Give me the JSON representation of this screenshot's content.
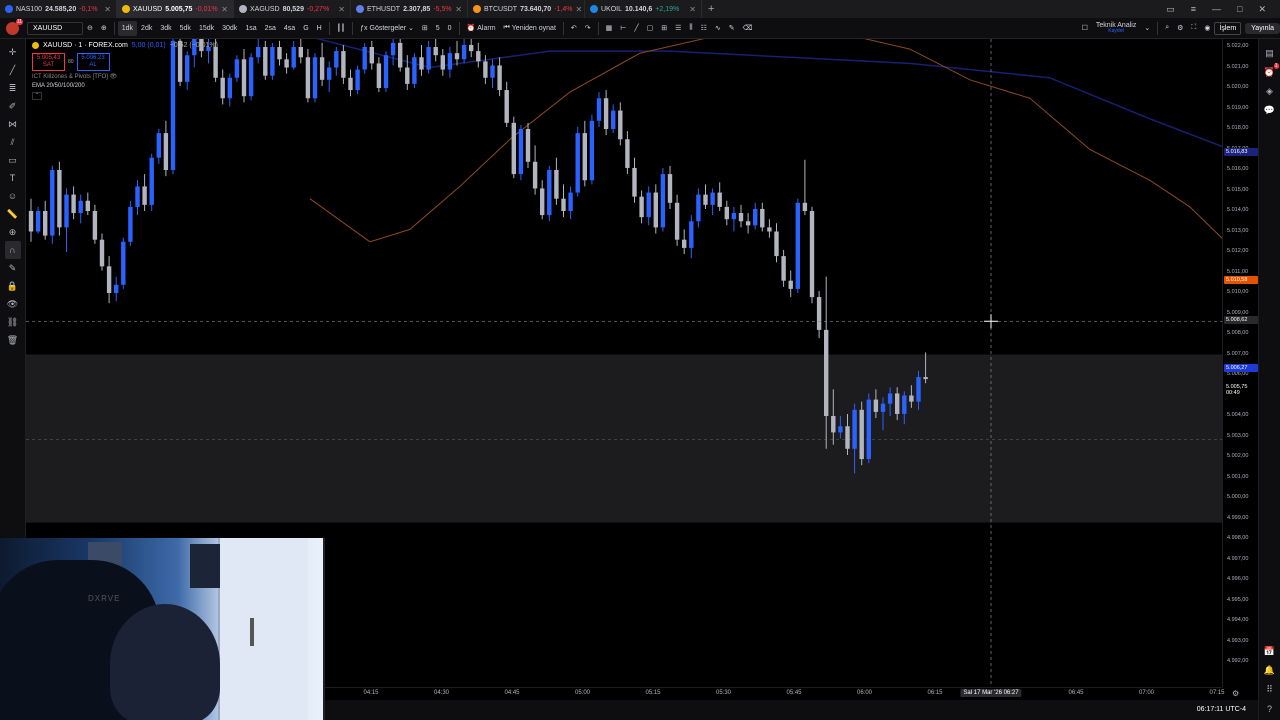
{
  "tabs": [
    {
      "symbol": "NAS100",
      "price": "24.585,20",
      "change": "-0,1%",
      "color": "#2962ff",
      "up": false
    },
    {
      "symbol": "XAUUSD",
      "price": "5.005,75",
      "change": "-0,01%",
      "color": "#f0b90b",
      "up": false,
      "active": true
    },
    {
      "symbol": "XAGUSD",
      "price": "80,529",
      "change": "-0,27%",
      "color": "#b2b5be",
      "up": false
    },
    {
      "symbol": "ETHUSDT",
      "price": "2.307,85",
      "change": "-5,5%",
      "color": "#627eea",
      "up": false
    },
    {
      "symbol": "BTCUSDT",
      "price": "73.640,70",
      "change": "-1,4%",
      "color": "#f7931a",
      "up": false
    },
    {
      "symbol": "UKOIL",
      "price": "10.140,6",
      "change": "+2,19%",
      "color": "#1e88e5",
      "up": true
    }
  ],
  "toolbar": {
    "symbol": "XAUUSD",
    "avatar_badge": "11",
    "intervals": [
      "1dk",
      "2dk",
      "3dk",
      "5dk",
      "15dk",
      "30dk",
      "1sa",
      "2sa",
      "4sa",
      "G",
      "H"
    ],
    "selected_interval": "1dk",
    "indicators_label": "Göstergeler",
    "templates_count": "5",
    "alerts_count": "0",
    "alarm_label": "Alarm",
    "replay_label": "Yeniden oynat",
    "analysis_label": "Teknik Analiz",
    "analysis_sub": "Kaydet",
    "trade_label": "İşlem",
    "publish_label": "Yayınla"
  },
  "legend": {
    "title": "XAUUSD · 1 · FOREX.com",
    "ohlc": "5,00 (0,01)",
    "change": "−0,52 (−0,01%)",
    "sell_price": "5.005,43",
    "sell_label": "SAT",
    "spread": "80",
    "buy_price": "5.006,23",
    "buy_label": "AL",
    "indicator1": "ICT Killzones & Pivots [TFO]",
    "indicator2": "EMA 20/50/100/200"
  },
  "price_axis": {
    "ticks": [
      "5.022,00",
      "5.021,00",
      "5.020,00",
      "5.019,00",
      "5.018,00",
      "5.017,00",
      "5.016,00",
      "5.015,00",
      "5.014,00",
      "5.013,00",
      "5.012,00",
      "5.011,00",
      "5.010,00",
      "5.009,00",
      "5.008,00",
      "5.007,00",
      "5.006,00",
      "5.005,00",
      "5.004,00",
      "5.003,00",
      "5.002,00",
      "5.001,00",
      "5.000,00",
      "4.999,00",
      "4.998,00",
      "4.997,00",
      "4.996,00",
      "4.995,00",
      "4.994,00",
      "4.993,00",
      "4.992,00"
    ],
    "label_ema_blue": "5.016,83",
    "label_ema_orange": "5.010,58",
    "label_crosshair": "5.008,62",
    "label_bid": "5.006,27",
    "label_last": "5.005,75",
    "label_countdown": "00:49"
  },
  "time_axis": {
    "ticks": [
      "04:15",
      "04:30",
      "04:45",
      "05:00",
      "05:15",
      "05:30",
      "05:45",
      "06:00",
      "06:15",
      "06:45",
      "07:00",
      "07:15"
    ],
    "crosshair_date": "Sal 17 Mar '26",
    "crosshair_time": "06:27"
  },
  "status": {
    "clock": "06:17:11 UTC-4"
  },
  "chart_data": {
    "type": "candlestick",
    "x_start": "04:02",
    "x_step_minutes": 1,
    "ylim": [
      4991.5,
      5022.5
    ],
    "xlim": [
      "04:00",
      "07:15"
    ],
    "candles": [
      [
        5014.0,
        5014.6,
        5012.5,
        5013.0
      ],
      [
        5013.0,
        5014.2,
        5012.9,
        5014.0
      ],
      [
        5014.0,
        5014.5,
        5012.6,
        5012.8
      ],
      [
        5012.8,
        5016.2,
        5012.4,
        5016.0
      ],
      [
        5016.0,
        5016.4,
        5012.8,
        5013.2
      ],
      [
        5013.2,
        5015.1,
        5012.0,
        5014.8
      ],
      [
        5014.8,
        5015.2,
        5013.6,
        5013.9
      ],
      [
        5013.9,
        5014.8,
        5013.4,
        5014.5
      ],
      [
        5014.5,
        5014.9,
        5013.8,
        5014.0
      ],
      [
        5014.0,
        5014.3,
        5012.4,
        5012.6
      ],
      [
        5012.6,
        5012.9,
        5011.1,
        5011.3
      ],
      [
        5011.3,
        5011.8,
        5009.5,
        5010.0
      ],
      [
        5010.0,
        5010.8,
        5009.6,
        5010.4
      ],
      [
        5010.4,
        5012.7,
        5010.2,
        5012.5
      ],
      [
        5012.5,
        5014.5,
        5012.3,
        5014.2
      ],
      [
        5014.2,
        5015.5,
        5013.8,
        5015.2
      ],
      [
        5015.2,
        5015.8,
        5014.0,
        5014.3
      ],
      [
        5014.3,
        5016.8,
        5014.0,
        5016.6
      ],
      [
        5016.6,
        5018.0,
        5016.3,
        5017.8
      ],
      [
        5017.8,
        5018.4,
        5015.7,
        5016.0
      ],
      [
        5016.0,
        5022.5,
        5015.8,
        5022.3
      ],
      [
        5022.3,
        5022.8,
        5020.1,
        5020.3
      ],
      [
        5020.3,
        5021.8,
        5019.9,
        5021.6
      ],
      [
        5021.6,
        5022.7,
        5021.0,
        5022.4
      ],
      [
        5022.4,
        5022.9,
        5021.5,
        5021.8
      ],
      [
        5021.8,
        5022.4,
        5021.2,
        5022.0
      ],
      [
        5022.0,
        5022.6,
        5020.3,
        5020.5
      ],
      [
        5020.5,
        5020.9,
        5019.2,
        5019.5
      ],
      [
        5019.5,
        5020.7,
        5019.1,
        5020.5
      ],
      [
        5020.5,
        5021.6,
        5020.3,
        5021.4
      ],
      [
        5021.4,
        5021.9,
        5019.3,
        5019.6
      ],
      [
        5019.6,
        5021.7,
        5019.4,
        5021.5
      ],
      [
        5021.5,
        5022.4,
        5021.2,
        5022.0
      ],
      [
        5022.0,
        5022.3,
        5020.4,
        5020.6
      ],
      [
        5020.6,
        5022.2,
        5020.4,
        5022.0
      ],
      [
        5022.0,
        5022.3,
        5021.1,
        5021.4
      ],
      [
        5021.4,
        5021.7,
        5020.7,
        5021.0
      ],
      [
        5021.0,
        5022.3,
        5020.9,
        5022.0
      ],
      [
        5022.0,
        5022.5,
        5021.2,
        5021.5
      ],
      [
        5021.5,
        5021.9,
        5019.3,
        5019.5
      ],
      [
        5019.5,
        5021.7,
        5019.3,
        5021.5
      ],
      [
        5021.5,
        5022.2,
        5020.1,
        5020.4
      ],
      [
        5020.4,
        5021.3,
        5019.8,
        5021.0
      ],
      [
        5021.0,
        5022.0,
        5020.6,
        5021.8
      ],
      [
        5021.8,
        5022.1,
        5020.2,
        5020.5
      ],
      [
        5020.5,
        5020.9,
        5019.6,
        5019.9
      ],
      [
        5019.9,
        5021.1,
        5019.7,
        5020.9
      ],
      [
        5020.9,
        5022.2,
        5020.7,
        5022.0
      ],
      [
        5022.0,
        5022.3,
        5020.9,
        5021.2
      ],
      [
        5021.2,
        5021.5,
        5019.8,
        5020.0
      ],
      [
        5020.0,
        5021.8,
        5019.8,
        5021.6
      ],
      [
        5021.6,
        5022.4,
        5021.1,
        5022.2
      ],
      [
        5022.2,
        5022.5,
        5020.8,
        5021.0
      ],
      [
        5021.0,
        5021.6,
        5019.9,
        5020.2
      ],
      [
        5020.2,
        5021.7,
        5020.0,
        5021.5
      ],
      [
        5021.5,
        5022.1,
        5020.6,
        5020.9
      ],
      [
        5020.9,
        5022.3,
        5020.7,
        5022.0
      ],
      [
        5022.0,
        5022.5,
        5021.3,
        5021.6
      ],
      [
        5021.6,
        5021.9,
        5020.6,
        5020.9
      ],
      [
        5020.9,
        5022.0,
        5020.5,
        5021.7
      ],
      [
        5021.7,
        5022.3,
        5021.1,
        5021.4
      ],
      [
        5021.4,
        5022.4,
        5021.2,
        5022.1
      ],
      [
        5022.1,
        5022.6,
        5021.5,
        5021.8
      ],
      [
        5021.8,
        5022.2,
        5021.0,
        5021.3
      ],
      [
        5021.3,
        5021.6,
        5020.2,
        5020.5
      ],
      [
        5020.5,
        5021.4,
        5020.0,
        5021.1
      ],
      [
        5021.1,
        5021.5,
        5019.6,
        5019.9
      ],
      [
        5019.9,
        5020.3,
        5018.1,
        5018.3
      ],
      [
        5018.3,
        5018.6,
        5015.6,
        5015.8
      ],
      [
        5015.8,
        5018.2,
        5015.5,
        5018.0
      ],
      [
        5018.0,
        5018.3,
        5016.1,
        5016.4
      ],
      [
        5016.4,
        5017.2,
        5014.8,
        5015.1
      ],
      [
        5015.1,
        5015.5,
        5013.6,
        5013.8
      ],
      [
        5013.8,
        5016.2,
        5013.5,
        5016.0
      ],
      [
        5016.0,
        5016.6,
        5014.3,
        5014.6
      ],
      [
        5014.6,
        5015.3,
        5013.7,
        5014.0
      ],
      [
        5014.0,
        5015.2,
        5013.6,
        5014.9
      ],
      [
        5014.9,
        5018.1,
        5014.7,
        5017.8
      ],
      [
        5017.8,
        5018.4,
        5015.2,
        5015.5
      ],
      [
        5015.5,
        5018.7,
        5015.3,
        5018.4
      ],
      [
        5018.4,
        5019.8,
        5018.1,
        5019.5
      ],
      [
        5019.5,
        5019.9,
        5017.7,
        5018.0
      ],
      [
        5018.0,
        5019.2,
        5017.8,
        5018.9
      ],
      [
        5018.9,
        5019.3,
        5017.2,
        5017.5
      ],
      [
        5017.5,
        5017.9,
        5015.8,
        5016.1
      ],
      [
        5016.1,
        5016.6,
        5014.4,
        5014.7
      ],
      [
        5014.7,
        5015.0,
        5013.4,
        5013.7
      ],
      [
        5013.7,
        5015.2,
        5013.3,
        5014.9
      ],
      [
        5014.9,
        5015.3,
        5012.9,
        5013.2
      ],
      [
        5013.2,
        5016.1,
        5013.0,
        5015.8
      ],
      [
        5015.8,
        5016.2,
        5014.1,
        5014.4
      ],
      [
        5014.4,
        5014.8,
        5012.3,
        5012.6
      ],
      [
        5012.6,
        5013.1,
        5011.9,
        5012.2
      ],
      [
        5012.2,
        5013.8,
        5011.7,
        5013.5
      ],
      [
        5013.5,
        5015.1,
        5013.2,
        5014.8
      ],
      [
        5014.8,
        5015.3,
        5014.1,
        5014.3
      ],
      [
        5014.3,
        5015.1,
        5013.8,
        5014.9
      ],
      [
        5014.9,
        5015.4,
        5014.0,
        5014.2
      ],
      [
        5014.2,
        5014.5,
        5013.3,
        5013.6
      ],
      [
        5013.6,
        5014.2,
        5013.0,
        5013.9
      ],
      [
        5013.9,
        5014.3,
        5013.2,
        5013.5
      ],
      [
        5013.5,
        5013.9,
        5012.9,
        5013.3
      ],
      [
        5013.3,
        5014.4,
        5013.1,
        5014.1
      ],
      [
        5014.1,
        5014.4,
        5013.0,
        5013.2
      ],
      [
        5013.2,
        5013.6,
        5012.7,
        5013.0
      ],
      [
        5013.0,
        5013.4,
        5011.5,
        5011.8
      ],
      [
        5011.8,
        5012.1,
        5010.3,
        5010.6
      ],
      [
        5010.6,
        5011.1,
        5009.8,
        5010.2
      ],
      [
        5010.2,
        5014.6,
        5010.0,
        5014.4
      ],
      [
        5014.4,
        5016.5,
        5013.8,
        5014.0
      ],
      [
        5014.0,
        5014.2,
        5009.5,
        5009.8
      ],
      [
        5009.8,
        5010.1,
        5007.8,
        5008.2
      ],
      [
        5008.2,
        5010.8,
        5002.4,
        5004.0
      ],
      [
        5004.0,
        5005.3,
        5002.6,
        5003.2
      ],
      [
        5003.2,
        5004.0,
        5002.9,
        5003.5
      ],
      [
        5003.5,
        5004.1,
        5002.1,
        5002.4
      ],
      [
        5002.4,
        5004.6,
        5001.2,
        5004.3
      ],
      [
        5004.3,
        5004.7,
        5001.6,
        5001.9
      ],
      [
        5001.9,
        5005.1,
        5001.7,
        5004.8
      ],
      [
        5004.8,
        5005.3,
        5003.9,
        5004.2
      ],
      [
        5004.2,
        5004.9,
        5003.3,
        5004.6
      ],
      [
        5004.6,
        5005.4,
        5004.0,
        5005.1
      ],
      [
        5005.1,
        5005.4,
        5003.8,
        5004.1
      ],
      [
        5004.1,
        5005.2,
        5003.6,
        5005.0
      ],
      [
        5005.0,
        5005.5,
        5004.4,
        5004.7
      ],
      [
        5004.7,
        5006.2,
        5004.3,
        5005.9
      ],
      [
        5005.9,
        5007.1,
        5005.6,
        5005.8
      ]
    ],
    "ema_blue": [
      [
        0,
        5022.5
      ],
      [
        120,
        5021.0
      ],
      [
        240,
        5021.8
      ],
      [
        360,
        5021.8
      ],
      [
        480,
        5021.5
      ],
      [
        600,
        5021.2
      ],
      [
        740,
        5020.5
      ],
      [
        840,
        5018.5
      ],
      [
        920,
        5017.0
      ]
    ],
    "ema_orange": [
      [
        0,
        5014.6
      ],
      [
        60,
        5012.5
      ],
      [
        100,
        5013.1
      ],
      [
        150,
        5015.2
      ],
      [
        200,
        5017.5
      ],
      [
        260,
        5019.8
      ],
      [
        330,
        5021.7
      ],
      [
        420,
        5022.7
      ],
      [
        520,
        5022.8
      ],
      [
        600,
        5021.9
      ],
      [
        660,
        5020.4
      ],
      [
        720,
        5019.5
      ],
      [
        780,
        5017.0
      ],
      [
        840,
        5015.5
      ],
      [
        880,
        5014.2
      ],
      [
        920,
        5012.3
      ]
    ],
    "last_price": 5005.75,
    "crosshair_price": 5008.62
  }
}
